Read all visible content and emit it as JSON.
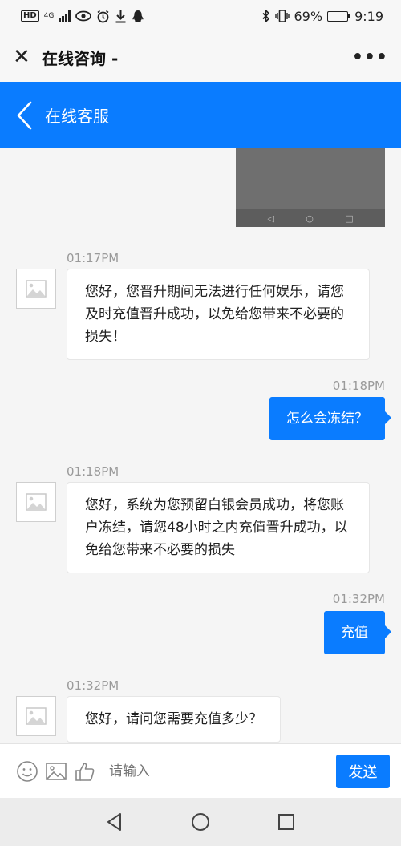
{
  "status_bar": {
    "hd_label": "HD",
    "network_label": "4G",
    "battery_text": "69%",
    "battery_level": 0.69,
    "time": "9:19",
    "left_icons": [
      "hd-icon",
      "signal-icon",
      "eye-icon",
      "alarm-icon",
      "download-icon",
      "qq-icon"
    ],
    "right_icons": [
      "bluetooth-icon",
      "vibrate-icon",
      "battery-icon"
    ]
  },
  "app_header": {
    "close_glyph": "✕",
    "title": "在线咨询 -",
    "more_glyph": "•••"
  },
  "service_header": {
    "title": "在线客服"
  },
  "chat": {
    "messages": [
      {
        "side": "in",
        "time": "01:17PM",
        "text": "您好，您晋升期间无法进行任何娱乐，请您及时充值晋升成功，以免给您带来不必要的损失！"
      },
      {
        "side": "out",
        "time": "01:18PM",
        "text": "怎么会冻结？"
      },
      {
        "side": "in",
        "time": "01:18PM",
        "text": "您好，系统为您预留白银会员成功，将您账户冻结，请您48小时之内充值晋升成功，以免给您带来不必要的损失"
      },
      {
        "side": "out",
        "time": "01:32PM",
        "text": "充值"
      },
      {
        "side": "in",
        "time": "01:32PM",
        "text": "您好，请问您需要充值多少？"
      }
    ]
  },
  "input_bar": {
    "placeholder": "请输入",
    "send_label": "发送"
  },
  "colors": {
    "accent": "#0a7cff",
    "background": "#f5f5f5"
  }
}
